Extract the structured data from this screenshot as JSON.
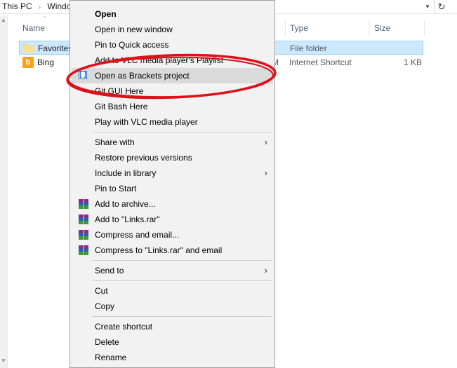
{
  "addressbar": {
    "crumbs": [
      "This PC",
      "Windo"
    ],
    "dropdown_icon": "chevron-down-icon",
    "refresh_icon": "refresh-icon"
  },
  "columns": {
    "name": "Name",
    "type": "Type",
    "size": "Size"
  },
  "files": [
    {
      "name": "Favorites",
      "type": "File folder",
      "size": "",
      "icon": "folder-icon",
      "selected": true
    },
    {
      "name": "Bing",
      "type": "Internet Shortcut",
      "size": "1 KB",
      "icon": "bing-icon",
      "selected": false,
      "modified_fragment": "M"
    }
  ],
  "bing_glyph": "b",
  "context_menu": {
    "groups": [
      {
        "items": [
          {
            "label": "Open",
            "bold": true
          },
          {
            "label": "Open in new window"
          },
          {
            "label": "Pin to Quick access"
          },
          {
            "label": "Add to VLC media player's Playlist"
          },
          {
            "label": "Open as Brackets project",
            "icon": "brackets-icon",
            "highlighted": true
          },
          {
            "label": "Git GUI Here"
          },
          {
            "label": "Git Bash Here"
          },
          {
            "label": "Play with VLC media player"
          }
        ]
      },
      {
        "items": [
          {
            "label": "Share with",
            "submenu": true
          },
          {
            "label": "Restore previous versions"
          },
          {
            "label": "Include in library",
            "submenu": true
          },
          {
            "label": "Pin to Start"
          },
          {
            "label": "Add to archive...",
            "icon": "winrar-icon"
          },
          {
            "label": "Add to \"Links.rar\"",
            "icon": "winrar-icon"
          },
          {
            "label": "Compress and email...",
            "icon": "winrar-icon"
          },
          {
            "label": "Compress to \"Links.rar\" and email",
            "icon": "winrar-icon"
          }
        ]
      },
      {
        "items": [
          {
            "label": "Send to",
            "submenu": true
          }
        ]
      },
      {
        "items": [
          {
            "label": "Cut"
          },
          {
            "label": "Copy"
          }
        ]
      },
      {
        "items": [
          {
            "label": "Create shortcut"
          },
          {
            "label": "Delete"
          },
          {
            "label": "Rename"
          }
        ]
      }
    ]
  },
  "colors": {
    "annotation": "#e0101a",
    "selection": "#cce8ff",
    "menu_bg": "#f2f2f2",
    "menu_highlight": "#dadada"
  }
}
